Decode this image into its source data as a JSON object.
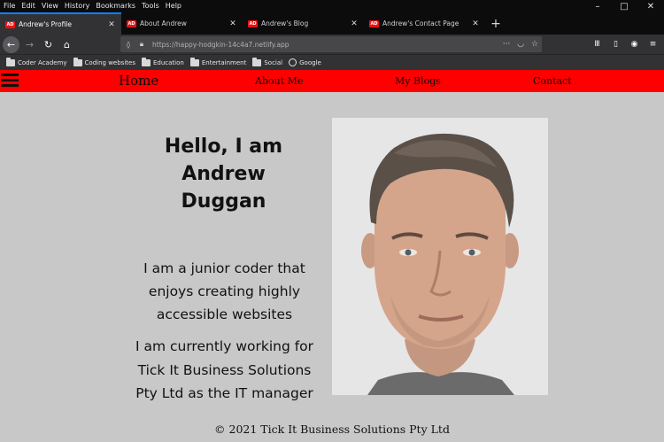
{
  "menubar": {
    "items": [
      "File",
      "Edit",
      "View",
      "History",
      "Bookmarks",
      "Tools",
      "Help"
    ]
  },
  "tabs": [
    {
      "favicon": "AD",
      "title": "Andrew's Profile",
      "active": true
    },
    {
      "favicon": "AD",
      "title": "About Andrew",
      "active": false
    },
    {
      "favicon": "AD",
      "title": "Andrew's Blog",
      "active": false
    },
    {
      "favicon": "AD",
      "title": "Andrew's Contact Page",
      "active": false
    }
  ],
  "navigation": {
    "url": "https://happy-hodgkin-14c4a7.netlify.app"
  },
  "bookmarks": [
    "Coder Academy",
    "Coding websites",
    "Education",
    "Entertainment",
    "Social",
    "Google"
  ],
  "site_nav": {
    "home": "Home",
    "about": "About Me",
    "blogs": "My Blogs",
    "contact": "Contact"
  },
  "hero": {
    "title_line1": "Hello, I am",
    "title_line2": "Andrew",
    "title_line3": "Duggan"
  },
  "intro": {
    "line1": "I am a junior coder that",
    "line2": "enjoys creating highly",
    "line3": "accessible websites"
  },
  "job": {
    "line1": "I am currently working for",
    "line2": "Tick It Business Solutions",
    "line3": "Pty Ltd as the IT manager"
  },
  "footer": {
    "copyright": "© 2021 Tick It Business Solutions Pty Ltd"
  },
  "colors": {
    "site_nav_bg": "#ff0000",
    "page_bg": "#c8c8c8",
    "chrome_dark": "#0c0c0d",
    "tab_accent": "#0a84ff"
  }
}
